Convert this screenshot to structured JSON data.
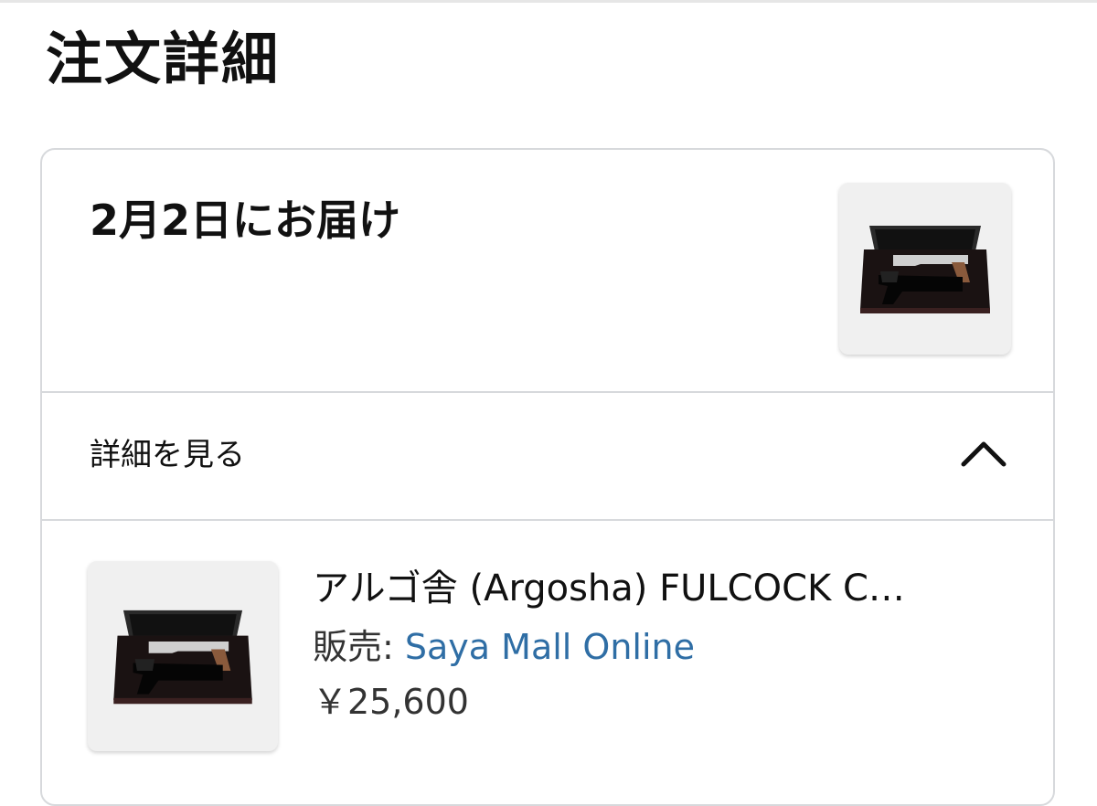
{
  "page": {
    "title": "注文詳細"
  },
  "delivery": {
    "title": "2月2日にお届け",
    "thumbnail_icon": "pistol-in-case-image"
  },
  "details": {
    "label": "詳細を見る",
    "toggle_icon": "chevron-up-icon"
  },
  "item": {
    "name": "アルゴ舎 (Argosha) FULCOCK C…",
    "seller_label": "販売: ",
    "seller_name": "Saya Mall Online",
    "price": "￥25,600",
    "thumbnail_icon": "pistol-in-case-image"
  },
  "colors": {
    "link": "#2f6ea5",
    "border": "#d7d9dc",
    "thumb_bg": "#f0f0f0"
  }
}
